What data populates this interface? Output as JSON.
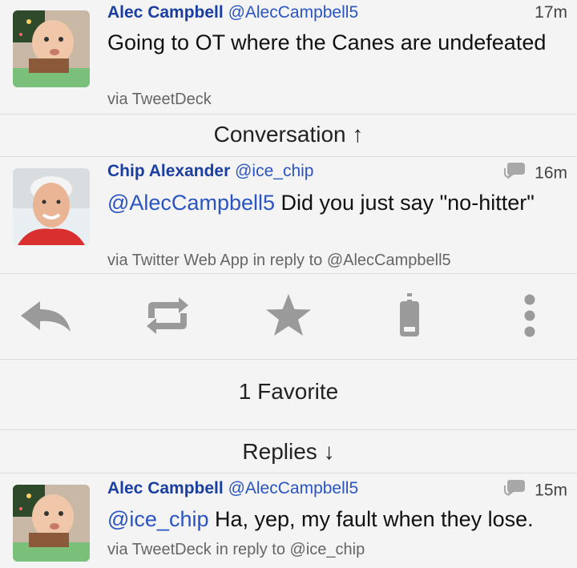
{
  "tweet1": {
    "name": "Alec Campbell",
    "handle": "@AlecCampbell5",
    "time": "17m",
    "text": "Going to OT where the Canes are undefeated",
    "via": "via TweetDeck"
  },
  "conversation_label": "Conversation ↑",
  "tweet2": {
    "name": "Chip Alexander",
    "handle": "@ice_chip",
    "time": "16m",
    "mention": "@AlecCampbell5",
    "text": " Did you just say \"no-hitter\"",
    "via": "via Twitter Web App in reply to @AlecCampbell5"
  },
  "actions": {
    "icons": [
      "reply-icon",
      "retweet-icon",
      "favorite-icon",
      "share-phone-icon",
      "more-icon"
    ]
  },
  "favorites_label": "1 Favorite",
  "replies_label": "Replies ↓",
  "tweet3": {
    "name": "Alec Campbell",
    "handle": "@AlecCampbell5",
    "time": "15m",
    "mention": "@ice_chip",
    "text": " Ha, yep, my fault when they lose.",
    "via": "via TweetDeck in reply to @ice_chip"
  },
  "colors": {
    "accent_name": "#1a3fa0",
    "link": "#2a55c0",
    "icon_gray": "#9a9a9a"
  }
}
